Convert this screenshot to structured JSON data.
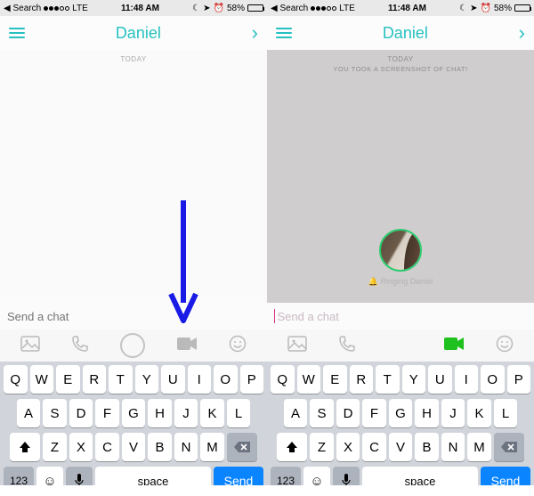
{
  "status": {
    "back_app": "Search",
    "carrier": "LTE",
    "time": "11:48 AM",
    "battery_pct": "58%"
  },
  "nav": {
    "title": "Daniel"
  },
  "chat": {
    "today": "TODAY",
    "screenshot_notice": "YOU TOOK A SCREENSHOT OF CHAT!",
    "ringing": "Ringing Daniel"
  },
  "input": {
    "placeholder": "Send a chat"
  },
  "keyboard": {
    "row1": [
      "Q",
      "W",
      "E",
      "R",
      "T",
      "Y",
      "U",
      "I",
      "O",
      "P"
    ],
    "row2": [
      "A",
      "S",
      "D",
      "F",
      "G",
      "H",
      "J",
      "K",
      "L"
    ],
    "row3": [
      "Z",
      "X",
      "C",
      "V",
      "B",
      "N",
      "M"
    ],
    "numkey": "123",
    "space": "space",
    "send": "Send"
  }
}
